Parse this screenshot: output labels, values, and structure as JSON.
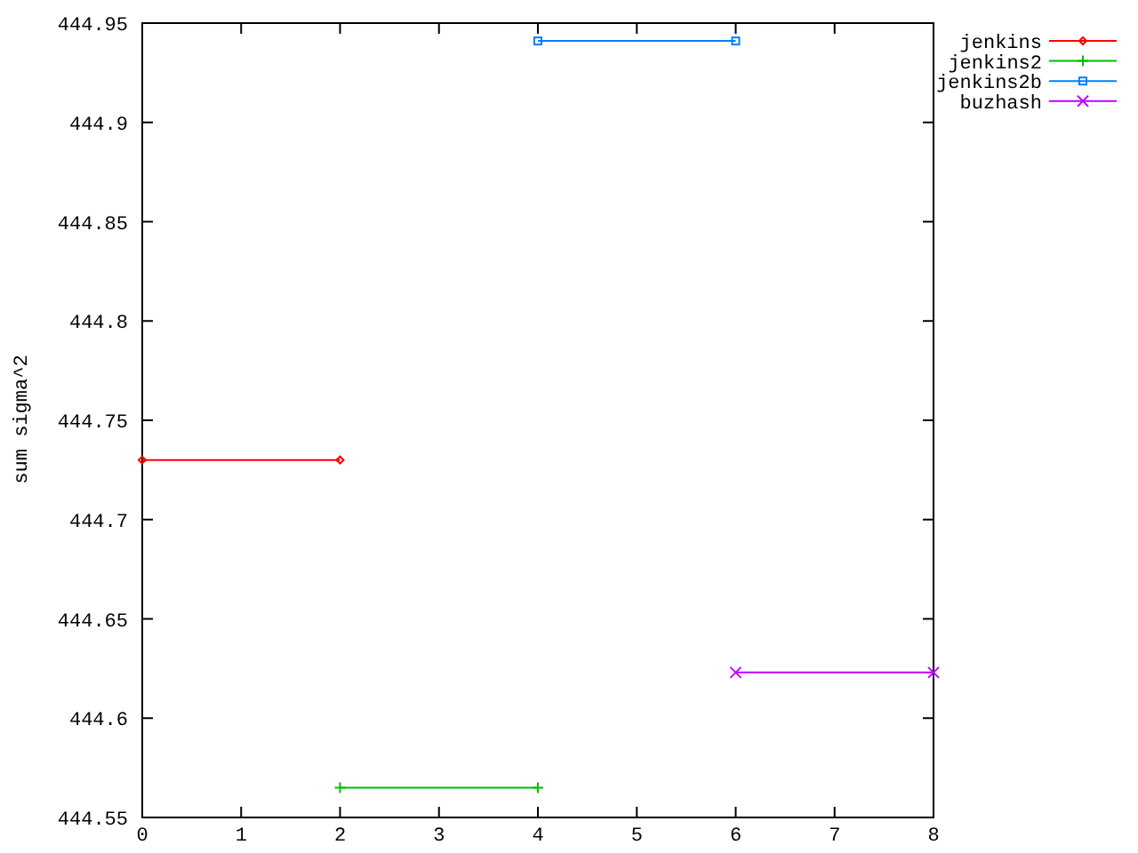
{
  "chart_data": {
    "type": "line",
    "ylabel": "sum sigma^2",
    "x": [
      0,
      2,
      4,
      6,
      8
    ],
    "xlim": [
      0,
      8
    ],
    "ylim": [
      444.55,
      444.95
    ],
    "xticks": [
      0,
      1,
      2,
      3,
      4,
      5,
      6,
      7,
      8
    ],
    "yticks": [
      {
        "value": 444.55,
        "label": "444.55"
      },
      {
        "value": 444.6,
        "label": "444.6"
      },
      {
        "value": 444.65,
        "label": "444.65"
      },
      {
        "value": 444.7,
        "label": "444.7"
      },
      {
        "value": 444.75,
        "label": "444.75"
      },
      {
        "value": 444.8,
        "label": "444.8"
      },
      {
        "value": 444.85,
        "label": "444.85"
      },
      {
        "value": 444.9,
        "label": "444.9"
      },
      {
        "value": 444.95,
        "label": "444.95"
      }
    ],
    "legend": true,
    "series": [
      {
        "name": "jenkins",
        "color": "#ff0000",
        "marker": "diamond",
        "values": [
          444.73,
          444.73,
          null,
          null,
          null
        ]
      },
      {
        "name": "jenkins2",
        "color": "#00c000",
        "marker": "plus",
        "values": [
          null,
          444.565,
          444.565,
          null,
          null
        ]
      },
      {
        "name": "jenkins2b",
        "color": "#0080ff",
        "marker": "square",
        "values": [
          null,
          null,
          444.941,
          444.941,
          null
        ]
      },
      {
        "name": "buzhash",
        "color": "#c000ff",
        "marker": "cross",
        "values": [
          null,
          null,
          null,
          444.623,
          444.623
        ]
      }
    ]
  }
}
